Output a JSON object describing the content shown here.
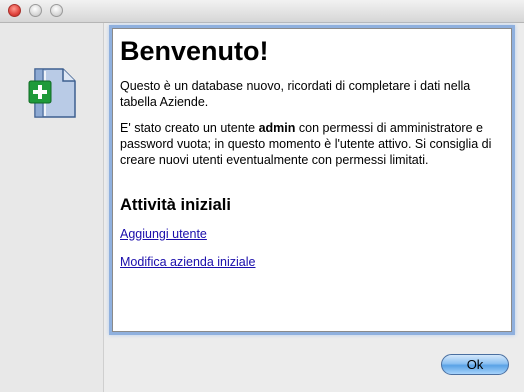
{
  "window": {
    "controls": [
      "close",
      "minimize",
      "zoom"
    ]
  },
  "sidebar": {
    "icon": "new-database-document-icon"
  },
  "content": {
    "title": "Benvenuto!",
    "paragraph1": "Questo è un database nuovo, ricordati di completare i dati nella tabella Aziende.",
    "paragraph2": {
      "before": "E' stato creato un utente ",
      "bold": "admin",
      "after": " con permessi di amministratore e password vuota; in questo momento è l'utente attivo. Si consiglia di creare nuovi utenti eventualmente con permessi limitati."
    },
    "section_title": "Attività iniziali",
    "links": [
      "Aggiungi utente",
      "Modifica azienda iniziale"
    ]
  },
  "footer": {
    "ok_label": "Ok"
  },
  "colors": {
    "link": "#1a0dab",
    "focus_ring": "#8fb0de",
    "button": "#5aa2e6"
  }
}
